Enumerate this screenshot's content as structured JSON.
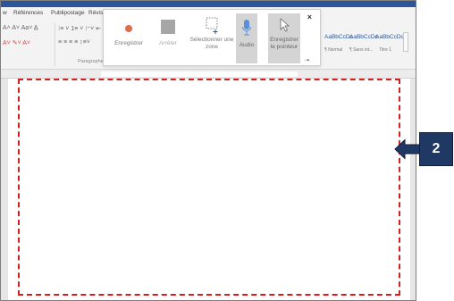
{
  "ribbon": {
    "tabs": [
      "w",
      "Références",
      "Publipostage",
      "Révis"
    ],
    "font_row": "A˄ A˅  Aa˅  A̲",
    "color_row": "A˅  ✎˅  A˅",
    "para_row1": "⁝≡ ˅ 1≡ ˅ ⁝⁼˅  ⇤",
    "para_row2": "≡  ≡  ≡  ≡  ↕≡˅",
    "paragraph_group": "Paragraphe",
    "styles": [
      {
        "sample": "AaBbCcDc",
        "caption": "¶ Normal"
      },
      {
        "sample": "AaBbCcDc",
        "caption": "¶ Sans int..."
      },
      {
        "sample": "AaBbCcDc",
        "caption": "Titre 1"
      }
    ]
  },
  "recorder": {
    "record_label": "Enregistrer",
    "stop_label": "Arrêter",
    "select_area_label": "Sélectionner une zone",
    "audio_label": "Audio",
    "record_pointer_label": "Enregistrer le pointeur",
    "close_glyph": "×",
    "pin_glyph": "⇥"
  },
  "callout": {
    "number": "2"
  },
  "colors": {
    "record_dot": "#e06c4a",
    "selection_border": "#d31f1f",
    "callout_fill": "#1f3864",
    "accent": "#2b579a"
  },
  "icons": [
    "record-icon",
    "stop-icon",
    "select-area-icon",
    "microphone-icon",
    "pointer-icon",
    "close-icon",
    "pin-icon",
    "arrow-left-icon"
  ]
}
